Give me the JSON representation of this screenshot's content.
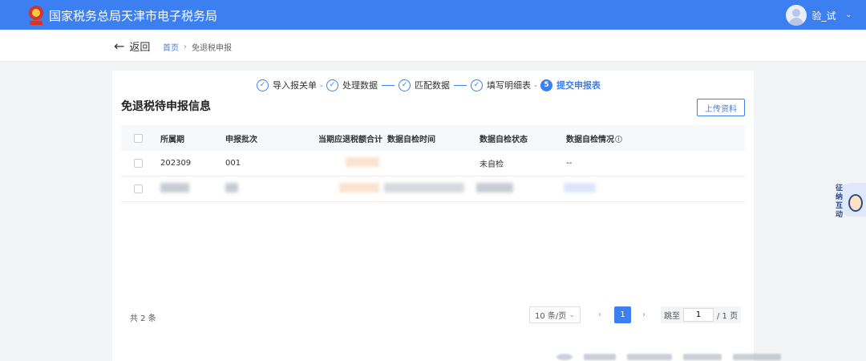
{
  "header": {
    "site_title": "国家税务总局天津市电子税务局",
    "user_name": "验_试",
    "brand_color": "#3c7ff0"
  },
  "subheader": {
    "back_label": "返回",
    "breadcrumb": [
      "首页",
      "免退税申报"
    ]
  },
  "stepper": {
    "steps": [
      {
        "label": "导入报关单",
        "state": "done",
        "connector": "-"
      },
      {
        "label": "处理数据",
        "state": "done",
        "connector": "—"
      },
      {
        "label": "匹配数据",
        "state": "done",
        "connector": "—"
      },
      {
        "label": "填写明细表",
        "state": "done",
        "connector": "-"
      },
      {
        "label": "提交申报表",
        "state": "active",
        "number": "5"
      }
    ]
  },
  "main": {
    "title": "免退税待申报信息",
    "upload_button": "上传资料"
  },
  "table": {
    "columns": [
      "所属期",
      "申报批次",
      "当期应退税额合计",
      "数据自检时间",
      "数据自检状态",
      "数据自检情况"
    ],
    "rows": [
      {
        "period": "202309",
        "batch": "001",
        "refund_total": "",
        "check_time": "",
        "check_status": "未自检",
        "check_result": "--"
      }
    ]
  },
  "pagination": {
    "total": "共 2 条",
    "page_size": "10 条/页",
    "current_page": "1",
    "jump_label": "跳至",
    "jump_value": "1",
    "page_suffix": "/ 1 页"
  },
  "assistant": {
    "label": "征纳互动"
  },
  "icons": {
    "back": "arrow-left-icon",
    "step_done": "check-circle-icon",
    "info": "info-circle-icon",
    "dropdown": "chevron-down-icon",
    "prev": "chevron-left-icon",
    "next": "chevron-right-icon"
  }
}
